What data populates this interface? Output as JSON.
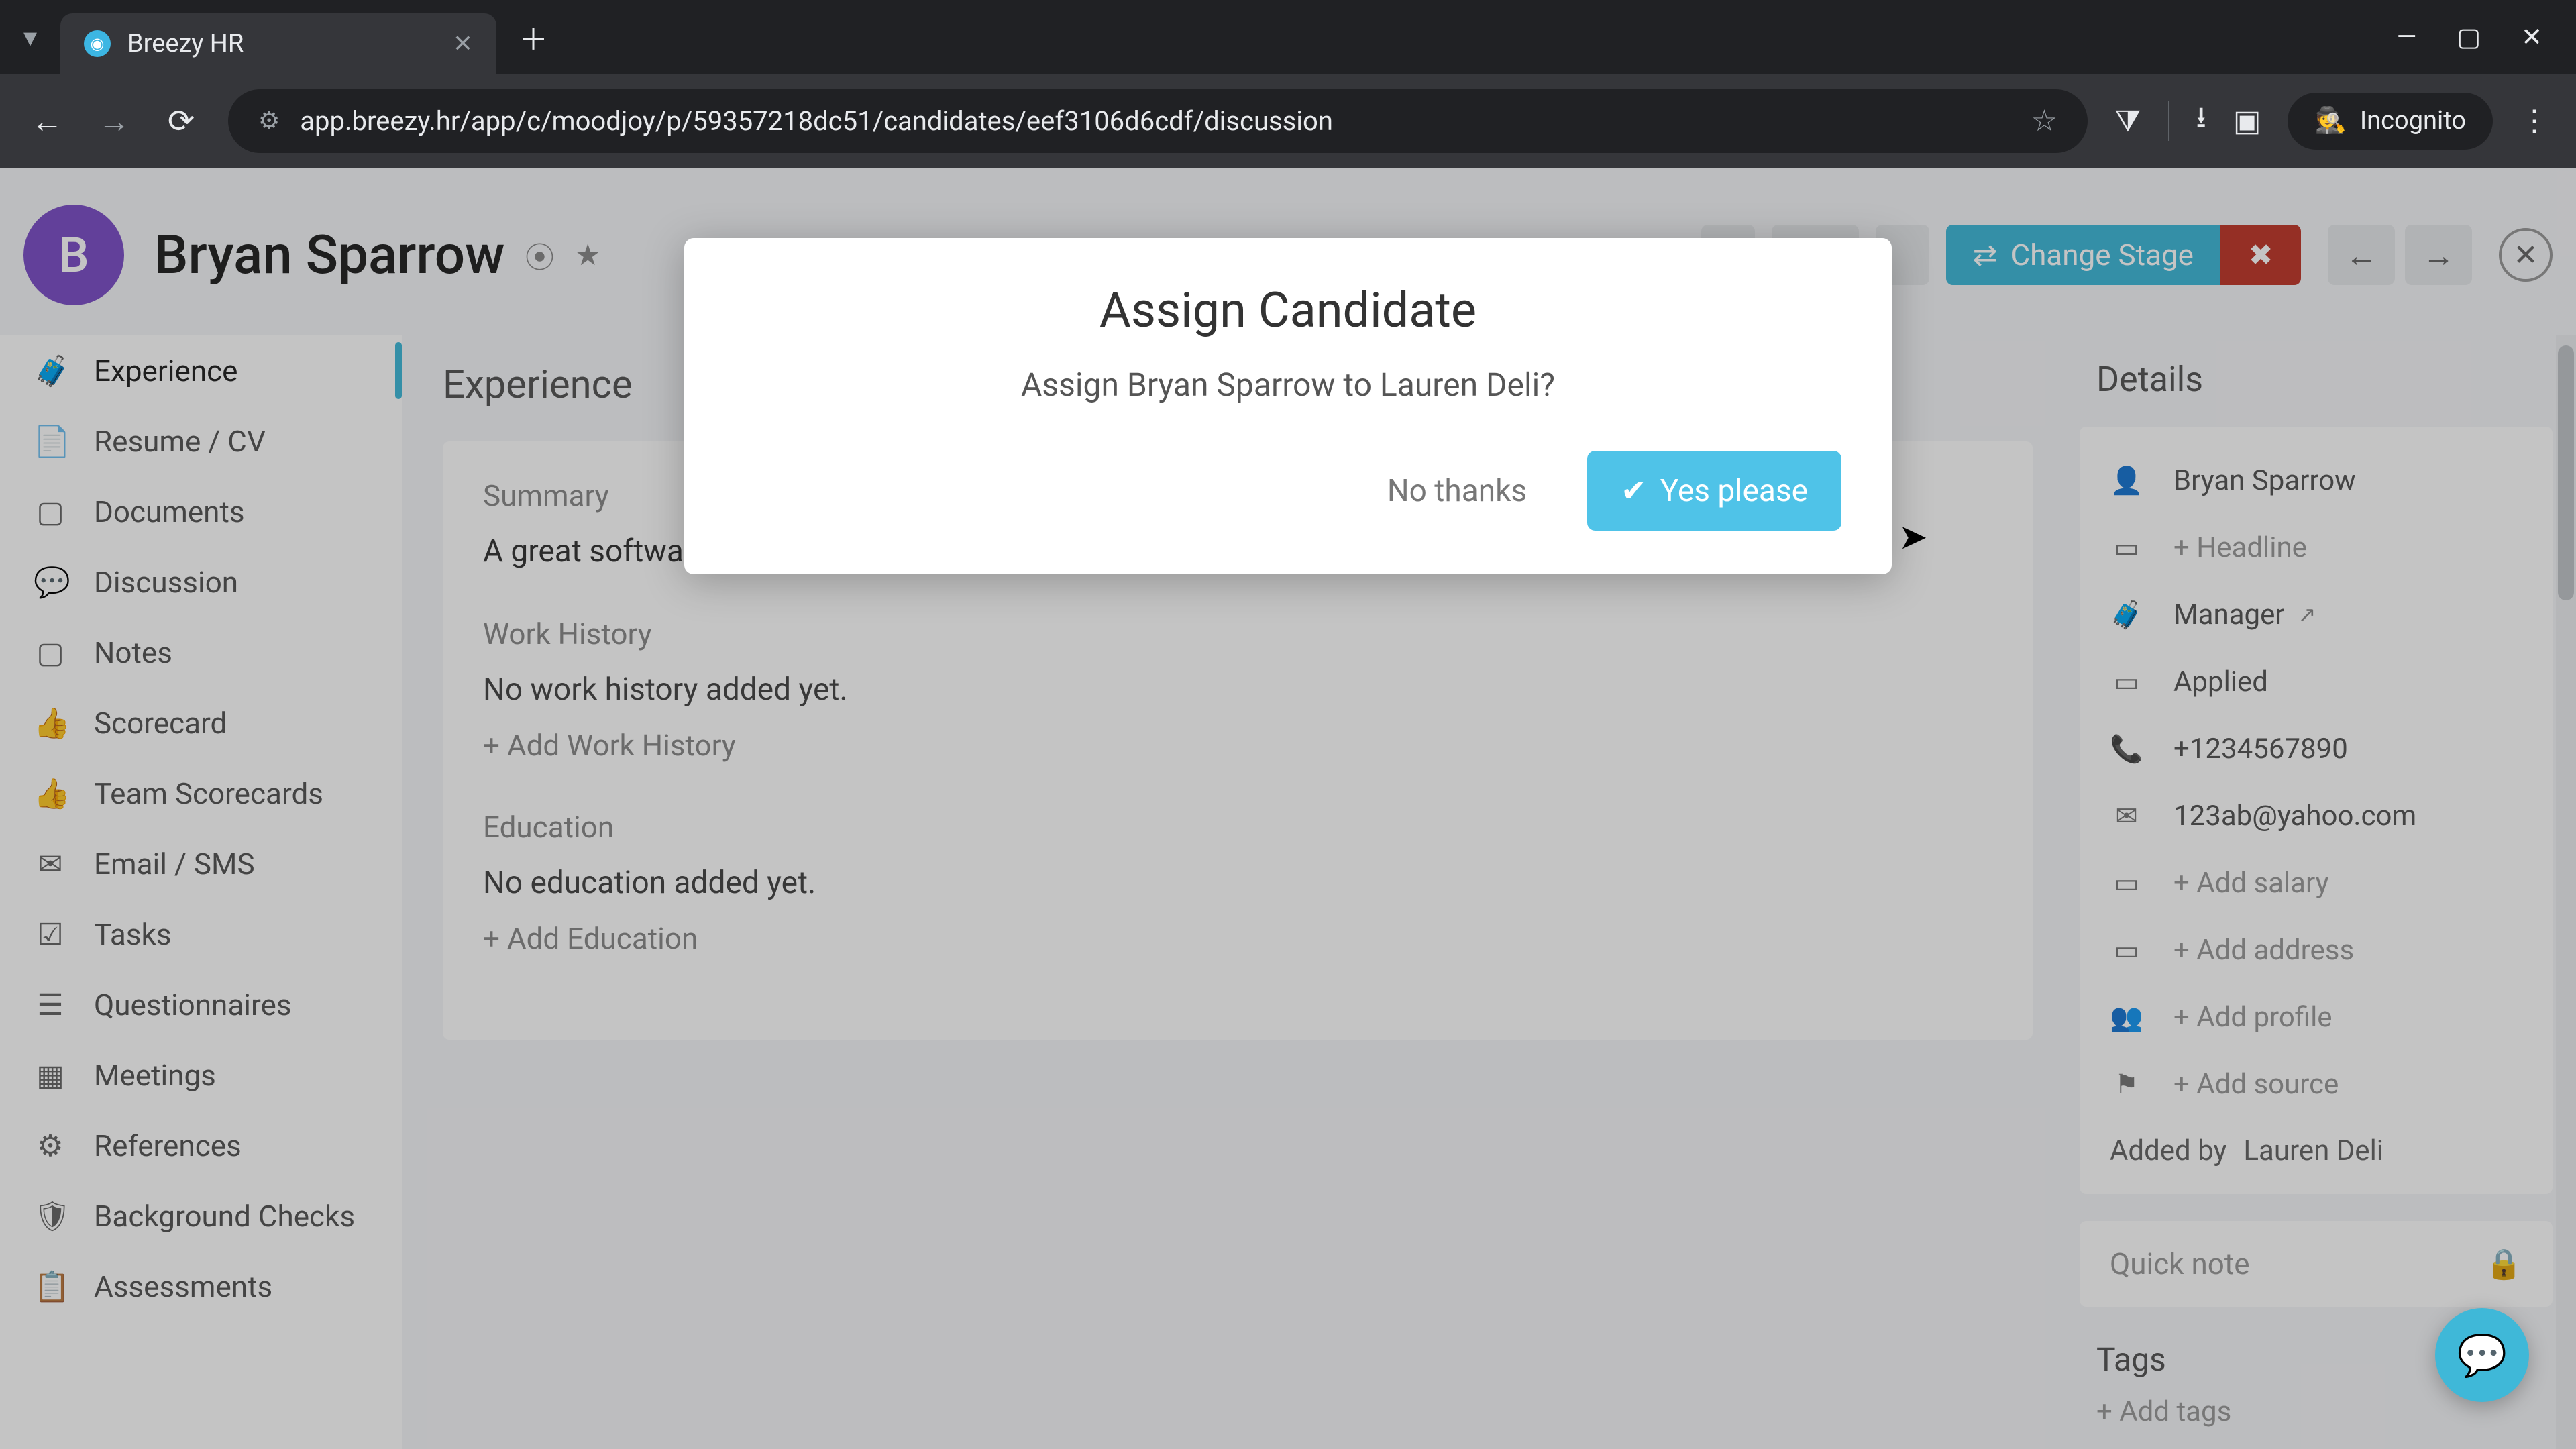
{
  "browser": {
    "tab_title": "Breezy HR",
    "url": "app.breezy.hr/app/c/moodjoy/p/59357218dc51/candidates/eef3106d6cdf/discussion",
    "incognito_label": "Incognito"
  },
  "header": {
    "avatar_initial": "B",
    "candidate_name": "Bryan Sparrow",
    "change_stage_label": "Change Stage"
  },
  "sidebar": {
    "items": [
      {
        "icon": "briefcase",
        "label": "Experience",
        "active": true
      },
      {
        "icon": "file",
        "label": "Resume / CV"
      },
      {
        "icon": "file-blank",
        "label": "Documents"
      },
      {
        "icon": "chat",
        "label": "Discussion"
      },
      {
        "icon": "note",
        "label": "Notes"
      },
      {
        "icon": "thumbs-up",
        "label": "Scorecard"
      },
      {
        "icon": "thumbs-up",
        "label": "Team Scorecards"
      },
      {
        "icon": "mail",
        "label": "Email / SMS"
      },
      {
        "icon": "check-square",
        "label": "Tasks"
      },
      {
        "icon": "list",
        "label": "Questionnaires"
      },
      {
        "icon": "calendar",
        "label": "Meetings"
      },
      {
        "icon": "gear",
        "label": "References"
      },
      {
        "icon": "shield",
        "label": "Background Checks"
      },
      {
        "icon": "clipboard",
        "label": "Assessments"
      }
    ]
  },
  "main": {
    "title": "Experience",
    "summary_label": "Summary",
    "summary_body": "A great software",
    "work_label": "Work History",
    "work_empty": "No work history added yet.",
    "work_add": "+ Add Work History",
    "edu_label": "Education",
    "edu_empty": "No education added yet.",
    "edu_add": "+ Add Education"
  },
  "details": {
    "title": "Details",
    "name": "Bryan Sparrow",
    "headline_placeholder": "+ Headline",
    "role": "Manager",
    "status": "Applied",
    "phone": "+1234567890",
    "email": "123ab@yahoo.com",
    "salary_placeholder": "+ Add salary",
    "address_placeholder": "+ Add address",
    "profile_placeholder": "+ Add profile",
    "source_placeholder": "+ Add source",
    "added_by_label": "Added by",
    "added_by_value": "Lauren Deli",
    "quick_note": "Quick note",
    "tags_title": "Tags",
    "add_tags": "+ Add tags"
  },
  "modal": {
    "title": "Assign Candidate",
    "body": "Assign Bryan Sparrow to Lauren Deli?",
    "no_label": "No thanks",
    "yes_label": "Yes please"
  }
}
